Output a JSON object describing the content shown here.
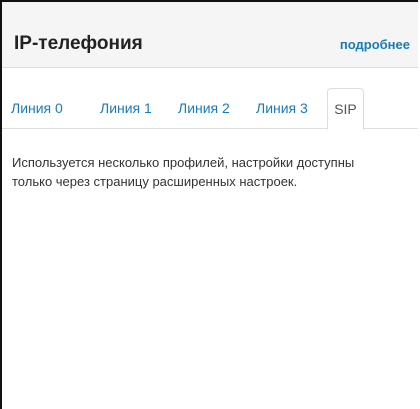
{
  "header": {
    "title": "IP-телефония",
    "more_link": "подробнее"
  },
  "tabs": [
    {
      "label": "Линия 0",
      "active": false
    },
    {
      "label": "Линия 1",
      "active": false
    },
    {
      "label": "Линия 2",
      "active": false
    },
    {
      "label": "Линия 3",
      "active": false
    },
    {
      "label": "SIP",
      "active": true
    }
  ],
  "content": {
    "message": "Используется несколько профилей, настройки доступны только через страницу расширенных настроек."
  },
  "colors": {
    "link": "#1a7bb8",
    "header_bg": "#f5f5f5",
    "border": "#dddddd"
  }
}
